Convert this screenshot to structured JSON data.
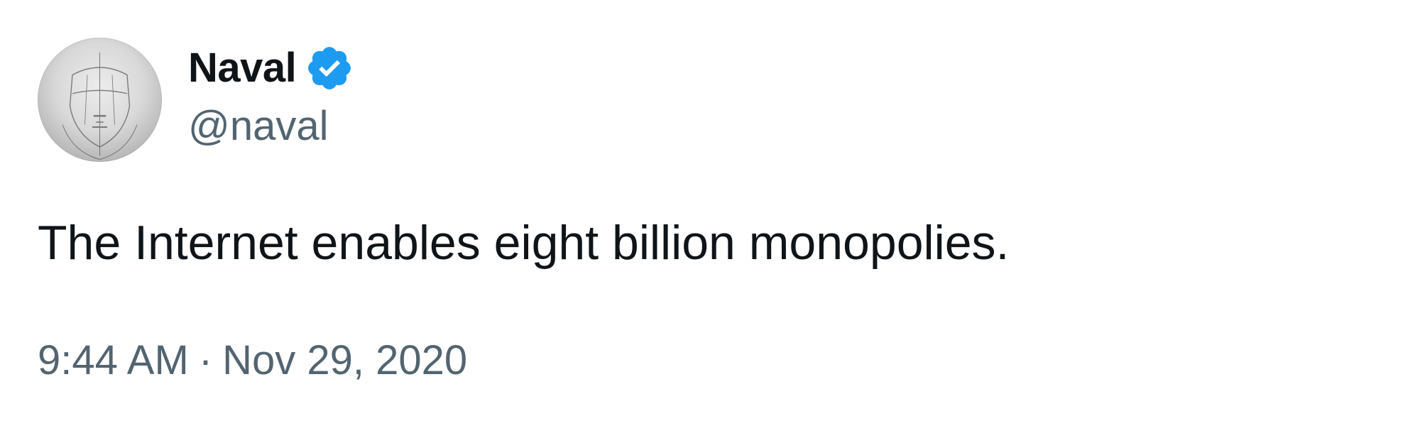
{
  "author": {
    "display_name": "Naval",
    "handle": "@naval",
    "verified": true,
    "avatar_icon": "sketch-face-avatar"
  },
  "tweet": {
    "text": "The Internet enables eight billion monopolies.",
    "time": "9:44 AM",
    "separator": "·",
    "date": "Nov 29, 2020"
  },
  "colors": {
    "text_primary": "#0f1419",
    "text_secondary": "#536471",
    "verified_blue": "#1d9bf0",
    "background": "#ffffff"
  }
}
